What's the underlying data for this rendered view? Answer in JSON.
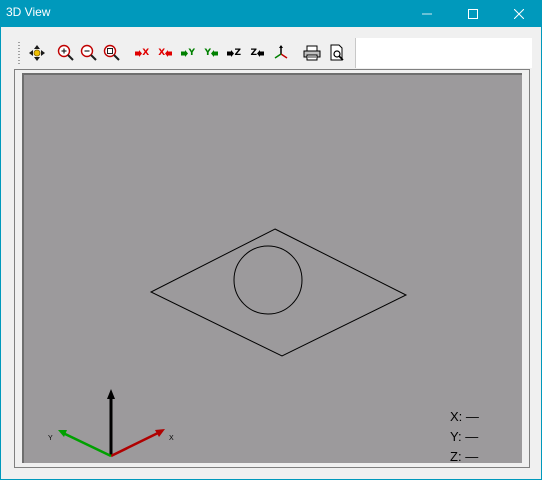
{
  "window": {
    "title": "3D View",
    "minimize_glyph": "—",
    "maximize_glyph": "□",
    "close_glyph": "✕"
  },
  "toolbar": {
    "buttons": [
      {
        "name": "pan-icon",
        "label": ""
      },
      {
        "name": "zoom-in-icon",
        "label": ""
      },
      {
        "name": "zoom-out-icon",
        "label": ""
      },
      {
        "name": "zoom-fit-icon",
        "label": ""
      },
      {
        "name": "view-plus-x-button",
        "label": "X"
      },
      {
        "name": "view-minus-x-button",
        "label": "X"
      },
      {
        "name": "view-plus-y-button",
        "label": "Y"
      },
      {
        "name": "view-minus-y-button",
        "label": "Y"
      },
      {
        "name": "view-plus-z-button",
        "label": "Z"
      },
      {
        "name": "view-minus-z-button",
        "label": "Z"
      },
      {
        "name": "axes-icon",
        "label": ""
      },
      {
        "name": "print-icon",
        "label": ""
      },
      {
        "name": "print-preview-icon",
        "label": ""
      }
    ],
    "colors": {
      "x": "#e00000",
      "y": "#008000",
      "z": "#000000"
    }
  },
  "viewport": {
    "background": "#9c9a9c",
    "triad": {
      "x_label": "X",
      "y_label": "Y"
    },
    "coords": {
      "x_label": "X:",
      "x_value": "—",
      "y_label": "Y:",
      "y_value": "—",
      "z_label": "Z:",
      "z_value": "—"
    }
  }
}
